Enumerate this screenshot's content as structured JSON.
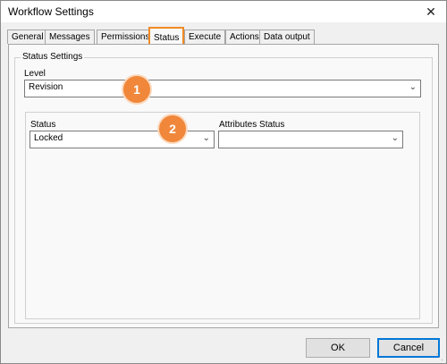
{
  "window": {
    "title": "Workflow Settings",
    "close_glyph": "✕"
  },
  "tabs": [
    {
      "label": "General"
    },
    {
      "label": "Messages"
    },
    {
      "label": "Permissions"
    },
    {
      "label": "Status",
      "active": true
    },
    {
      "label": "Execute"
    },
    {
      "label": "Actions"
    },
    {
      "label": "Data output"
    }
  ],
  "status_settings": {
    "group_label": "Status Settings",
    "level": {
      "label": "Level",
      "value": "Revision"
    },
    "status": {
      "label": "Status",
      "value": "Locked"
    },
    "attributes_status": {
      "label": "Attributes Status",
      "value": ""
    }
  },
  "annotations": {
    "badge1": "1",
    "badge2": "2"
  },
  "buttons": {
    "ok": "OK",
    "cancel": "Cancel"
  },
  "colors": {
    "accent": "#f0873a",
    "active_tab_border": "#f08a24",
    "primary_button_border": "#0078d7"
  },
  "icons": {
    "dropdown": "chevron-down-icon",
    "close": "close-icon",
    "resize": "resize-grip-icon"
  }
}
